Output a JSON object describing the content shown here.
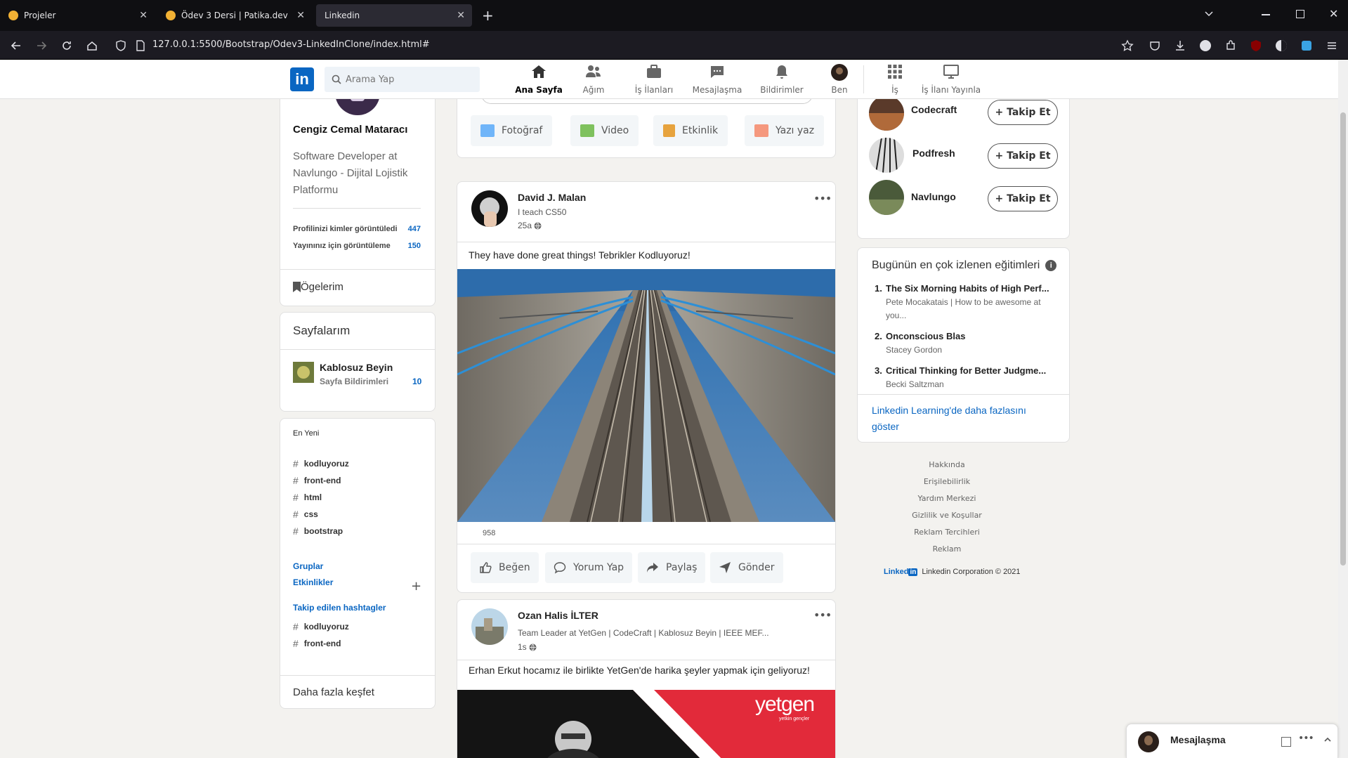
{
  "browser": {
    "tabs": [
      {
        "title": "Projeler"
      },
      {
        "title": "Ödev 3 Dersi | Patika.dev"
      },
      {
        "title": "Linkedin"
      }
    ],
    "url": "127.0.0.1:5500/Bootstrap/Odev3-LinkedInClone/index.html#"
  },
  "header": {
    "logo": "in",
    "search_placeholder": "Arama Yap",
    "nav": [
      {
        "label": "Ana Sayfa",
        "icon": "home-icon"
      },
      {
        "label": "Ağım",
        "icon": "network-icon"
      },
      {
        "label": "İş İlanları",
        "icon": "briefcase-icon"
      },
      {
        "label": "Mesajlaşma",
        "icon": "message-icon"
      },
      {
        "label": "Bildirimler",
        "icon": "bell-icon"
      },
      {
        "label": "Ben",
        "icon": "avatar"
      },
      {
        "label": "İş",
        "icon": "grid-icon"
      },
      {
        "label": "İş İlanı Yayınla",
        "icon": "monitor-icon"
      }
    ]
  },
  "profile": {
    "name": "Cengiz Cemal Mataracı",
    "headline": "Software Developer at Navlungo - Dijital Lojistik Platformu",
    "stats": [
      {
        "label": "Profilinizi kimler görüntüledi",
        "value": "447"
      },
      {
        "label": "Yayınınız için görüntüleme",
        "value": "150"
      }
    ],
    "items_label": "Ögelerim"
  },
  "pages": {
    "title": "Sayfalarım",
    "page_name": "Kablosuz Beyin",
    "page_sub": "Sayfa Bildirimleri",
    "page_count": "10"
  },
  "recent": {
    "title": "En Yeni",
    "hashtags": [
      "kodluyoruz",
      "front-end",
      "html",
      "css",
      "bootstrap"
    ],
    "groups": "Gruplar",
    "events": "Etkinlikler",
    "add": "+",
    "followed_title": "Takip edilen hashtagler",
    "followed": [
      "kodluyoruz",
      "front-end"
    ],
    "discover": "Daha fazla keşfet"
  },
  "share": {
    "buttons": [
      {
        "label": "Fotoğraf",
        "color": "#70b5f9"
      },
      {
        "label": "Video",
        "color": "#7fc15e"
      },
      {
        "label": "Etkinlik",
        "color": "#e7a33e"
      },
      {
        "label": "Yazı yaz",
        "color": "#f5987e"
      }
    ]
  },
  "posts": [
    {
      "author": "David J. Malan",
      "subtitle": "I teach CS50",
      "time": "25a",
      "text": "They have done great things! Tebrikler Kodluyoruz!",
      "likes": "958",
      "actions": [
        "Beğen",
        "Yorum Yap",
        "Paylaş",
        "Gönder"
      ]
    },
    {
      "author": "Ozan Halis İLTER",
      "subtitle": "Team Leader at YetGen | CodeCraft | Kablosuz Beyin | IEEE MEF...",
      "time": "1s",
      "text": "Erhan Erkut hocamız ile birlikte YetGen'de harika şeyler yapmak için geliyoruz!",
      "image_brand": "yetgen",
      "image_brand_sub": "yetkin gençler"
    }
  ],
  "follow": {
    "items": [
      {
        "name": "Codecraft",
        "button": "+ Takip Et"
      },
      {
        "name": "Podfresh",
        "button": "+ Takip Et"
      },
      {
        "name": "Navlungo",
        "button": "+ Takip Et"
      }
    ]
  },
  "learning": {
    "title": "Bugünün en çok izlenen eğitimleri",
    "courses": [
      {
        "n": "1.",
        "title": "The Six Morning Habits of High Perf...",
        "author": "Pete Mocakatais | How to be awesome at you..."
      },
      {
        "n": "2.",
        "title": "Onconscious Blas",
        "author": "Stacey Gordon"
      },
      {
        "n": "3.",
        "title": "Critical Thinking for Better Judgme...",
        "author": "Becki Saltzman"
      }
    ],
    "more": "Linkedin Learning'de daha fazlasını göster"
  },
  "footer": {
    "links": [
      "Hakkında",
      "Erişilebilirlik",
      "Yardım Merkezi",
      "Gizlilik ve Koşullar",
      "Reklam Tercihleri",
      "Reklam"
    ],
    "brand": "Linked",
    "brand_in": "in",
    "copyright": "Linkedin Corporation © 2021"
  },
  "messaging": {
    "label": "Mesajlaşma"
  }
}
